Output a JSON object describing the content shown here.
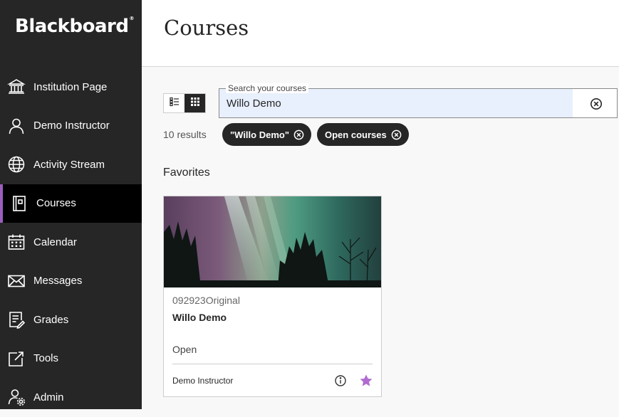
{
  "sidebar": {
    "logo": "Blackboard",
    "logo_mark": "®",
    "items": [
      {
        "label": "Institution Page",
        "icon": "institution-icon"
      },
      {
        "label": "Demo Instructor",
        "icon": "user-icon"
      },
      {
        "label": "Activity Stream",
        "icon": "globe-icon"
      },
      {
        "label": "Courses",
        "icon": "courses-icon",
        "active": true
      },
      {
        "label": "Calendar",
        "icon": "calendar-icon"
      },
      {
        "label": "Messages",
        "icon": "envelope-icon"
      },
      {
        "label": "Grades",
        "icon": "grades-icon"
      },
      {
        "label": "Tools",
        "icon": "tools-icon"
      },
      {
        "label": "Admin",
        "icon": "admin-icon"
      }
    ]
  },
  "header": {
    "title": "Courses"
  },
  "search": {
    "label": "Search your courses",
    "value": "Willo Demo"
  },
  "results": {
    "count_text": "10 results"
  },
  "filters": [
    {
      "label": "\"Willo Demo\""
    },
    {
      "label": "Open courses"
    }
  ],
  "favorites": {
    "heading": "Favorites",
    "card": {
      "code": "092923Original",
      "title": "Willo Demo",
      "status": "Open",
      "instructor": "Demo Instructor",
      "favorited": true
    }
  },
  "colors": {
    "sidebar_bg": "#262626",
    "active_accent": "#9b5ebf",
    "star": "#b06ad0",
    "search_fill": "#e8effd"
  }
}
